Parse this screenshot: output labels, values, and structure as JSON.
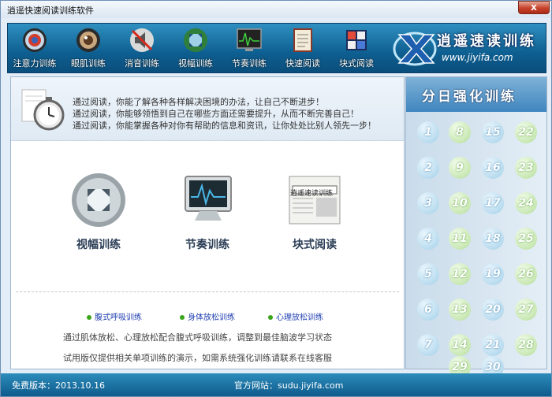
{
  "window": {
    "title": "逍遥快速阅读训练软件",
    "close": "x"
  },
  "toolbar": {
    "items": [
      {
        "label": "注意力训练",
        "icon": "target-icon"
      },
      {
        "label": "眼肌训练",
        "icon": "eye-icon"
      },
      {
        "label": "消音训练",
        "icon": "mute-icon"
      },
      {
        "label": "视幅训练",
        "icon": "expand-icon"
      },
      {
        "label": "节奏训练",
        "icon": "monitor-icon"
      },
      {
        "label": "快速阅读",
        "icon": "book-icon"
      },
      {
        "label": "块式阅读",
        "icon": "blocks-icon"
      }
    ]
  },
  "logo": {
    "title": "逍遥速读训练",
    "url": "www.jiyifa.com"
  },
  "banner": {
    "lines": [
      "通过阅读，你能了解各种各样解决困境的办法，让自己不断进步！",
      "通过阅读，你能够领悟到自己在哪些方面还需要提升，从而不断完善自己！",
      "通过阅读，你能掌握各种对你有帮助的信息和资讯，让你处处比别人领先一步！"
    ]
  },
  "features": [
    {
      "label": "视幅训练",
      "icon": "expand-icon"
    },
    {
      "label": "节奏训练",
      "icon": "monitor-icon"
    },
    {
      "label": "块式阅读",
      "icon": "newspaper-icon"
    }
  ],
  "newspaper_text": "逍遥速读训练",
  "mini_links": [
    "腹式呼吸训练",
    "身体放松训练",
    "心理放松训练"
  ],
  "description": [
    "通过肌体放松、心理放松配合腹式呼吸训练，调整到最佳脑波学习状态",
    "试用版仅提供相关单项训练的演示，如需系统强化训练请联系在线客服"
  ],
  "side_panel": {
    "title": "分日强化训练",
    "days": [
      "1",
      "8",
      "15",
      "22",
      "2",
      "9",
      "16",
      "23",
      "3",
      "10",
      "17",
      "24",
      "4",
      "11",
      "18",
      "25",
      "5",
      "12",
      "19",
      "26",
      "6",
      "13",
      "20",
      "27",
      "7",
      "14",
      "21",
      "28",
      "29",
      "30"
    ]
  },
  "status": {
    "version": "免费版本：2013.10.16",
    "site": "官方网站：sudu.jiyifa.com"
  },
  "colors": {
    "toolbar": "#0e5f91",
    "day_blue": "#b9dcef",
    "day_green": "#c9e8b4"
  }
}
